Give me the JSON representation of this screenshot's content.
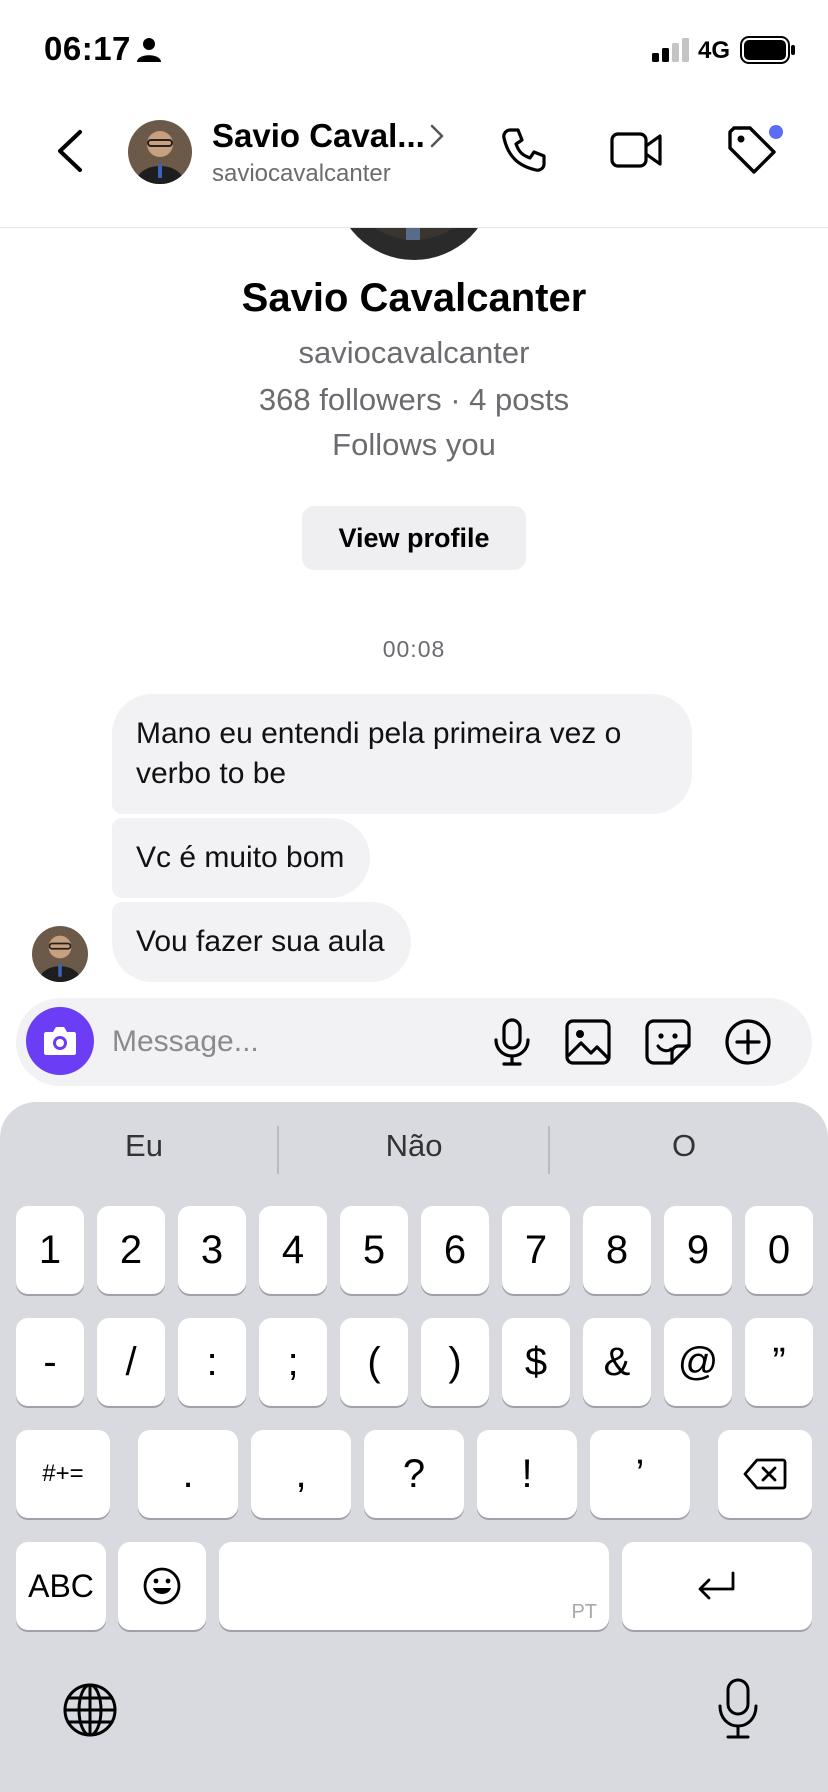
{
  "status_bar": {
    "time": "06:17",
    "network": "4G"
  },
  "header": {
    "name": "Savio Caval...",
    "username": "saviocavalcanter"
  },
  "profile": {
    "name": "Savio Cavalcanter",
    "username": "saviocavalcanter",
    "stats": "368 followers · 4 posts",
    "follows": "Follows you",
    "view_profile_label": "View profile"
  },
  "conversation": {
    "timestamp": "00:08",
    "messages": [
      "Mano eu entendi pela primeira vez o verbo to be",
      "Vc é muito bom",
      "Vou fazer sua aula"
    ]
  },
  "composer": {
    "placeholder": "Message..."
  },
  "keyboard": {
    "suggestions": [
      "Eu",
      "Não",
      "O"
    ],
    "row1": [
      "1",
      "2",
      "3",
      "4",
      "5",
      "6",
      "7",
      "8",
      "9",
      "0"
    ],
    "row2": [
      "-",
      "/",
      ":",
      ";",
      "(",
      ")",
      "$",
      "&",
      "@",
      "”"
    ],
    "row3_mode": "#+=",
    "row3": [
      ".",
      ",",
      "?",
      "!",
      "’"
    ],
    "abc_label": "ABC",
    "space_language": "PT"
  },
  "colors": {
    "accent": "#6b3ef5",
    "notification_dot": "#5b6cf6",
    "bubble": "#f2f2f4",
    "keyboard_bg": "#d8dadf"
  },
  "icons": [
    "person-icon",
    "signal-icon",
    "battery-icon",
    "back-icon",
    "chevron-right-icon",
    "phone-icon",
    "video-icon",
    "tag-icon",
    "camera-icon",
    "mic-icon",
    "gallery-icon",
    "sticker-icon",
    "plus-icon",
    "backspace-icon",
    "emoji-icon",
    "return-icon",
    "globe-icon",
    "dictation-icon"
  ]
}
